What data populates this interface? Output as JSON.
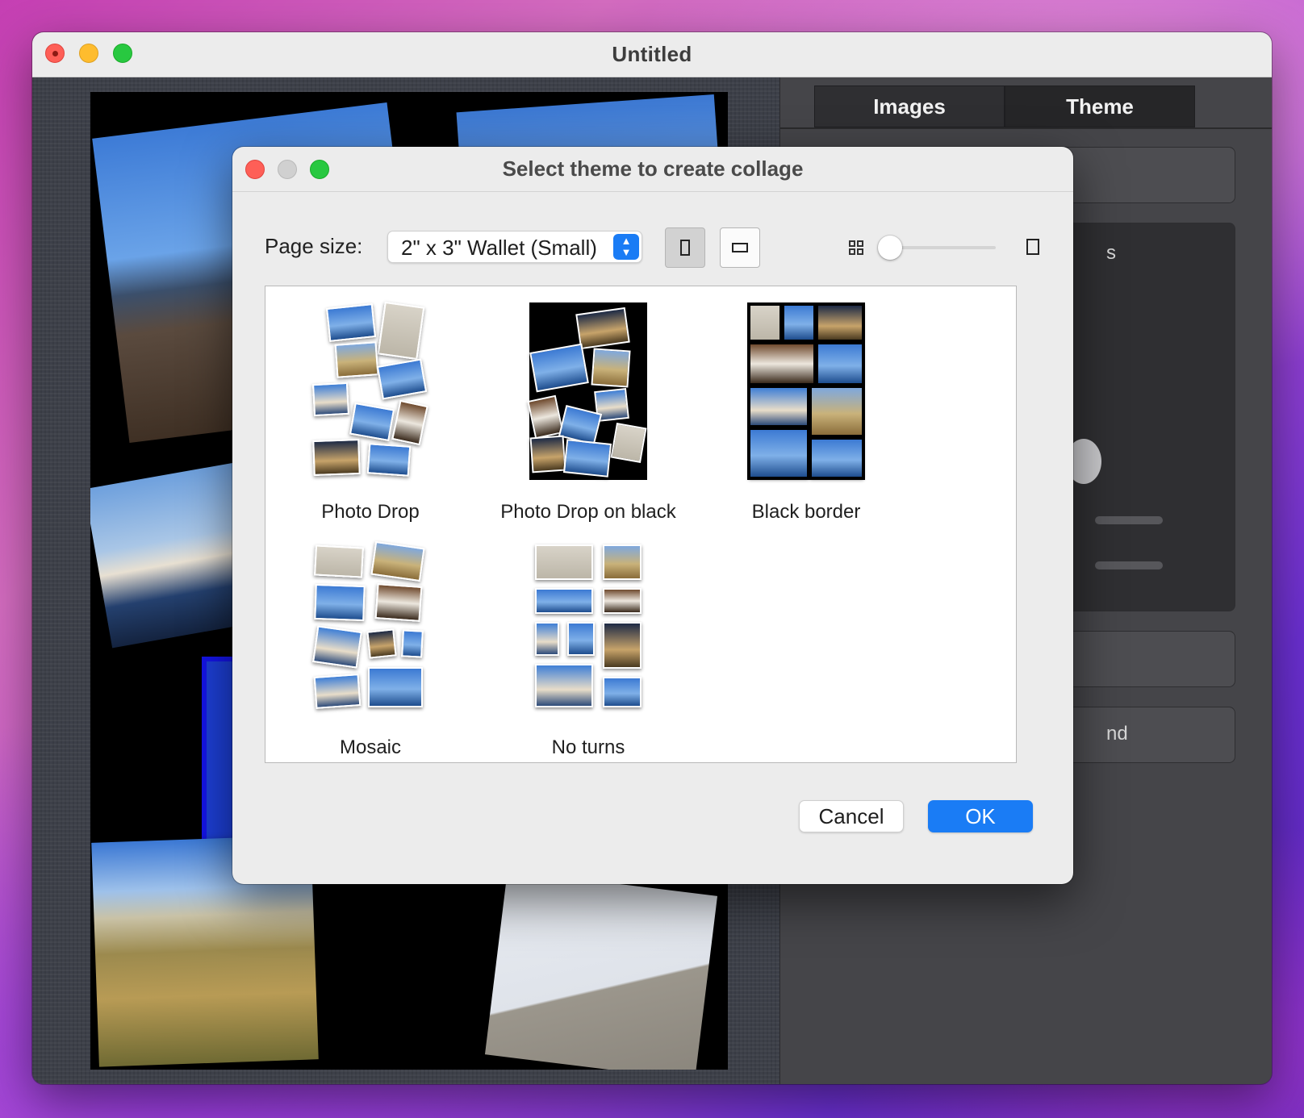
{
  "window": {
    "title": "Untitled"
  },
  "sidebar": {
    "tabs": [
      {
        "label": "Images"
      },
      {
        "label": "Theme"
      }
    ],
    "partial_labels": [
      "s",
      "nd"
    ]
  },
  "dialog": {
    "title": "Select theme to create collage",
    "page_size_label": "Page size:",
    "page_size_value": "2\" x 3\" Wallet (Small)",
    "orientation": "portrait",
    "zoom_fraction": 0.0,
    "themes": [
      {
        "label": "Photo Drop"
      },
      {
        "label": "Photo Drop on black"
      },
      {
        "label": "Black border"
      },
      {
        "label": "Mosaic"
      },
      {
        "label": "No turns"
      }
    ],
    "cancel_label": "Cancel",
    "ok_label": "OK"
  },
  "colors": {
    "accent": "#1a7cf5",
    "close": "#fe5f57",
    "minimize": "#febc2e",
    "zoom": "#28c840"
  },
  "icons": {
    "portrait": "portrait-orientation-icon",
    "landscape": "landscape-orientation-icon",
    "grid": "grid-small-icon",
    "single": "single-large-icon",
    "select": "chevron-up-down-icon"
  }
}
